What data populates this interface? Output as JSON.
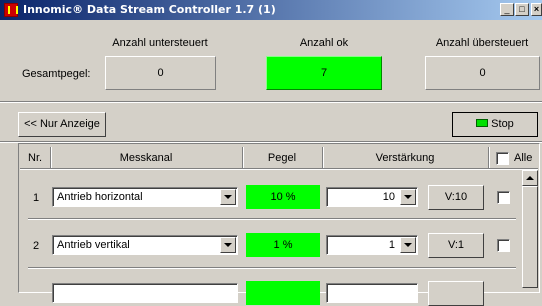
{
  "window": {
    "title": "Innomic® Data Stream Controller 1.7 (1)",
    "minimize_glyph": "_",
    "maximize_glyph": "□",
    "close_glyph": "×"
  },
  "summary": {
    "row_label": "Gesamtpegel:",
    "under_header": "Anzahl untersteuert",
    "ok_header": "Anzahl ok",
    "over_header": "Anzahl übersteuert",
    "under_value": "0",
    "ok_value": "7",
    "over_value": "0"
  },
  "toolbar": {
    "display_only_label": "<< Nur Anzeige",
    "stop_label": "Stop"
  },
  "table": {
    "headers": {
      "nr": "Nr.",
      "channel": "Messkanal",
      "level": "Pegel",
      "gain": "Verstärkung",
      "all": "Alle"
    },
    "rows": [
      {
        "nr": "1",
        "channel": "Antrieb horizontal",
        "level": "10 %",
        "gain": "10",
        "gain_button": "V:10",
        "checked": false
      },
      {
        "nr": "2",
        "channel": "Antrieb vertikal",
        "level": "1 %",
        "gain": "1",
        "gain_button": "V:1",
        "checked": false
      }
    ]
  },
  "colors": {
    "ok_green": "#00ff00",
    "titlebar_start": "#0a246a",
    "titlebar_end": "#a6caf0",
    "face": "#d4d0c8"
  }
}
